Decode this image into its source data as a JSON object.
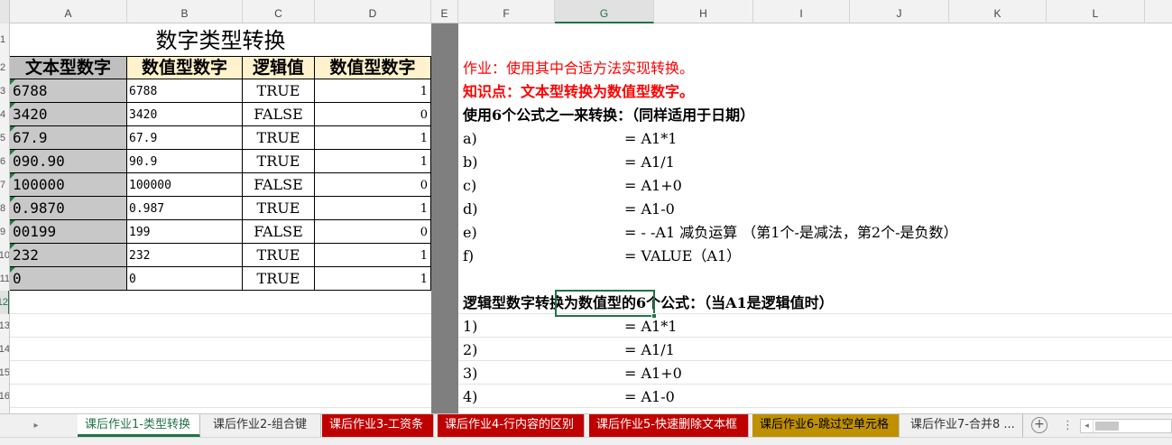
{
  "columns": [
    "A",
    "B",
    "C",
    "D",
    "E",
    "F",
    "G",
    "H",
    "I",
    "J",
    "K",
    "L"
  ],
  "selected_column": "G",
  "rows": [
    "1",
    "2",
    "3",
    "4",
    "5",
    "6",
    "7",
    "8",
    "9",
    "10",
    "11",
    "12",
    "13",
    "14",
    "15",
    "16"
  ],
  "selected_row": "12",
  "table": {
    "title": "数字类型转换",
    "headers": [
      "文本型数字",
      "数值型数字",
      "逻辑值",
      "数值型数字"
    ],
    "rows": [
      {
        "text": "6788",
        "num": "6788",
        "logic": "TRUE",
        "val": "1"
      },
      {
        "text": "3420",
        "num": "3420",
        "logic": "FALSE",
        "val": "0"
      },
      {
        "text": "67.9",
        "num": "67.9",
        "logic": "TRUE",
        "val": "1"
      },
      {
        "text": "090.90",
        "num": "90.9",
        "logic": "TRUE",
        "val": "1"
      },
      {
        "text": "100000",
        "num": "100000",
        "logic": "FALSE",
        "val": "0"
      },
      {
        "text": "0.9870",
        "num": "0.987",
        "logic": "TRUE",
        "val": "1"
      },
      {
        "text": "00199",
        "num": "199",
        "logic": "FALSE",
        "val": "0"
      },
      {
        "text": "232",
        "num": "232",
        "logic": "TRUE",
        "val": "1"
      },
      {
        "text": "0",
        "num": "0",
        "logic": "TRUE",
        "val": "1"
      }
    ]
  },
  "notes": {
    "assignment": "作业：使用其中合适方法实现转换。",
    "knowledge": "知识点：文本型转换为数值型数字。",
    "text_formulas_heading": "使用6个公式之一来转换：（同样适用于日期）",
    "text_formulas": [
      {
        "label": "a)",
        "formula": "= A1*1"
      },
      {
        "label": "b)",
        "formula": "= A1/1"
      },
      {
        "label": "c)",
        "formula": "= A1+0"
      },
      {
        "label": "d)",
        "formula": "= A1-0"
      },
      {
        "label": "e)",
        "formula": "= - -A1 减负运算  （第1个-是减法，第2个-是负数）"
      },
      {
        "label": "f)",
        "formula": "= VALUE（A1）"
      }
    ],
    "logic_formulas_heading": "逻辑型数字转换为数值型的6个公式：（当A1是逻辑值时）",
    "logic_formulas": [
      {
        "label": "1)",
        "formula": "= A1*1"
      },
      {
        "label": "2)",
        "formula": "= A1/1"
      },
      {
        "label": "3)",
        "formula": "= A1+0"
      },
      {
        "label": "4)",
        "formula": "= A1-0"
      }
    ]
  },
  "sheet_tabs": [
    {
      "label": "课后作业1-类型转换",
      "style": "active"
    },
    {
      "label": "课后作业2-组合键",
      "style": "plain"
    },
    {
      "label": "课后作业3-工资条",
      "style": "red"
    },
    {
      "label": "课后作业4-行内容的区别",
      "style": "red"
    },
    {
      "label": "课后作业5-快速删除文本框",
      "style": "red"
    },
    {
      "label": "课后作业6-跳过空单元格",
      "style": "gold"
    },
    {
      "label": "课后作业7-合并8 ...",
      "style": "plain"
    }
  ],
  "add_sheet_label": "+",
  "ellipsis_label": "⋮",
  "icons": {
    "nav_next": "▸",
    "scroll_left": "◂"
  },
  "colors": {
    "selection": "#217346",
    "red_tab": "#c00000",
    "gold_tab": "#bf9000",
    "header_fill": "#fff2cc",
    "text_col_fill": "#c8c8c8",
    "note_red": "#ff0000"
  }
}
